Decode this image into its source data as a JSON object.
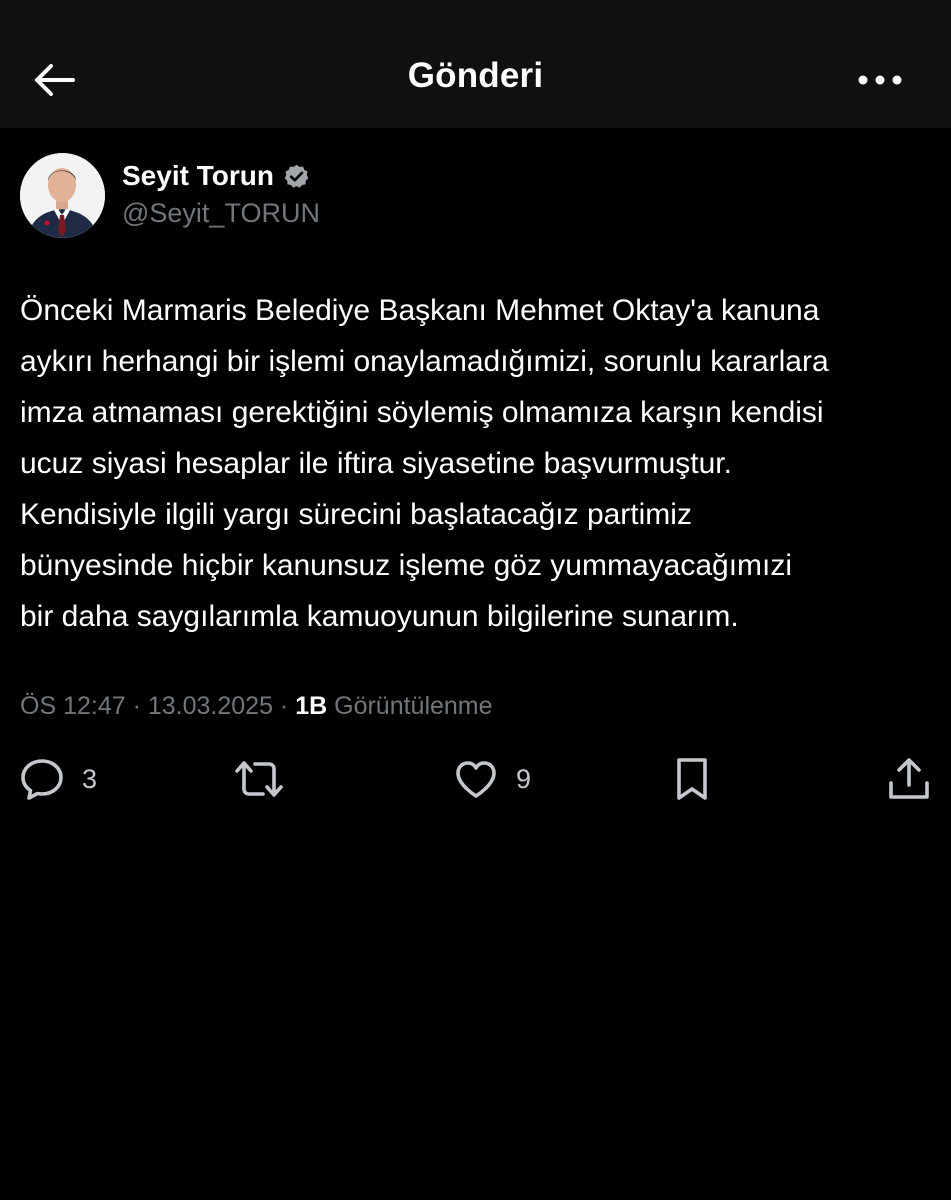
{
  "header": {
    "title": "Gönderi",
    "back_icon": "arrow-left-icon",
    "more_icon": "more-horizontal-icon"
  },
  "post": {
    "author": {
      "name": "Seyit Torun",
      "handle": "@Seyit_TORUN",
      "verified": true,
      "verified_color": "#a1a6ab"
    },
    "text_lines": [
      "Önceki Marmaris Belediye Başkanı Mehmet Oktay'a kanuna",
      "aykırı herhangi bir işlemi onaylamadığımizi, sorunlu kararlara",
      "imza atmaması gerektiğini söylemiş olmamıza karşın kendisi",
      "ucuz siyasi hesaplar ile iftira siyasetine başvurmuştur.",
      "Kendisiyle ilgili yargı sürecini başlatacağız partimiz",
      "bünyesinde hiçbir kanunsuz işleme göz yummayacağımızi",
      "bir daha saygılarımla kamuoyunun bilgilerine sunarım."
    ],
    "meta": {
      "time": "ÖS 12:47",
      "separator": " · ",
      "date": "13.03.2025",
      "views_count": "1B",
      "views_label": " Görüntülenme"
    },
    "actions": {
      "replies": "3",
      "likes": "9"
    }
  },
  "colors": {
    "background": "#000000",
    "header_background": "#101010",
    "text_primary": "#ffffff",
    "text_secondary": "#71767b"
  }
}
